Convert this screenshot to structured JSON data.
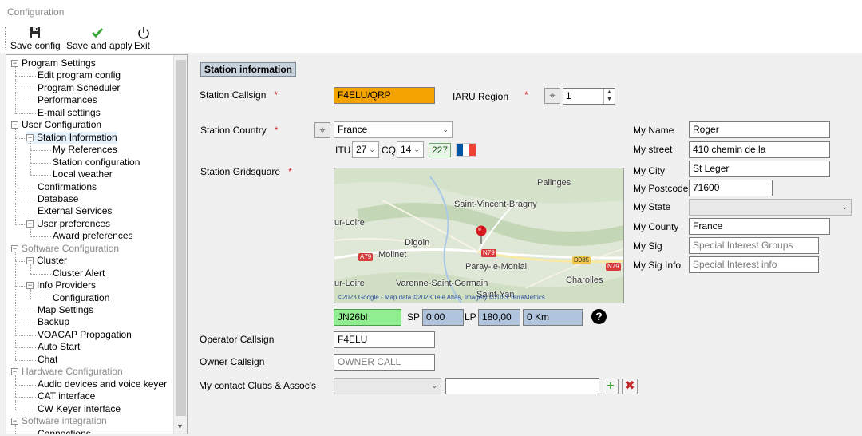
{
  "window": {
    "title": "Configuration"
  },
  "toolbar": {
    "save_config": "Save config",
    "save_and_apply": "Save and apply",
    "exit": "Exit"
  },
  "tree": [
    {
      "label": "Program Settings",
      "level": 0,
      "expanded": true
    },
    {
      "label": "Edit program config",
      "level": 1
    },
    {
      "label": "Program Scheduler",
      "level": 1
    },
    {
      "label": "Performances",
      "level": 1
    },
    {
      "label": "E-mail settings",
      "level": 1
    },
    {
      "label": "User Configuration",
      "level": 0,
      "expanded": true
    },
    {
      "label": "Station Information",
      "level": 1,
      "expanded": true,
      "selected": true
    },
    {
      "label": "My References",
      "level": 2
    },
    {
      "label": "Station configuration",
      "level": 2
    },
    {
      "label": "Local weather",
      "level": 2
    },
    {
      "label": "Confirmations",
      "level": 1
    },
    {
      "label": "Database",
      "level": 1
    },
    {
      "label": "External Services",
      "level": 1
    },
    {
      "label": "User preferences",
      "level": 1,
      "expanded": true
    },
    {
      "label": "Award preferences",
      "level": 2
    },
    {
      "label": "Software Configuration",
      "level": 0,
      "expanded": true,
      "grey": true
    },
    {
      "label": "Cluster",
      "level": 1,
      "expanded": true
    },
    {
      "label": "Cluster Alert",
      "level": 2
    },
    {
      "label": "Info Providers",
      "level": 1,
      "expanded": true
    },
    {
      "label": "Configuration",
      "level": 2
    },
    {
      "label": "Map Settings",
      "level": 1
    },
    {
      "label": "Backup",
      "level": 1
    },
    {
      "label": "VOACAP Propagation",
      "level": 1
    },
    {
      "label": "Auto Start",
      "level": 1
    },
    {
      "label": "Chat",
      "level": 1
    },
    {
      "label": "Hardware Configuration",
      "level": 0,
      "expanded": true,
      "grey": true
    },
    {
      "label": "Audio devices and voice keyer",
      "level": 1
    },
    {
      "label": "CAT interface",
      "level": 1
    },
    {
      "label": "CW Keyer interface",
      "level": 1
    },
    {
      "label": "Software integration",
      "level": 0,
      "expanded": true,
      "grey": true
    },
    {
      "label": "Connections",
      "level": 1
    }
  ],
  "station": {
    "section_title": "Station information",
    "required_mark": "*",
    "callsign_label": "Station Callsign",
    "callsign_value": "F4ELU/QRP",
    "iaru_label": "IARU Region",
    "iaru_value": "1",
    "country_label": "Station Country",
    "country_value": "France",
    "itu_label": "ITU",
    "itu_value": "27",
    "cq_label": "CQ",
    "cq_value": "14",
    "dxcc_value": "227",
    "gridsquare_label": "Station Gridsquare",
    "grid_value": "JN26bl",
    "sp_label": "SP",
    "sp_value": "0,00",
    "lp_label": "LP",
    "lp_value": "180,00",
    "distance_value": "0 Km",
    "operator_label": "Operator Callsign",
    "operator_value": "F4ELU",
    "owner_label": "Owner Callsign",
    "owner_placeholder": "OWNER CALL",
    "clubs_label": "My contact Clubs & Assoc's"
  },
  "map": {
    "places": [
      "Palinges",
      "Saint-Vincent-Bragny",
      "ur-Loire",
      "Digoin",
      "Molinet",
      "Paray-le-Monial",
      "Charolles",
      "ur-Loire",
      "Varenne-Saint-Germain",
      "Saint-Yan"
    ],
    "roads": [
      "A79",
      "N79",
      "D985",
      "N79"
    ],
    "attribution": "©2023 Google - Map data ©2023 Tele Atlas, Imagery ©2023 TerraMetrics"
  },
  "personal": {
    "name_label": "My Name",
    "name_value": "Roger",
    "street_label": "My street",
    "street_value": "410 chemin de la",
    "city_label": "My City",
    "city_value": "St Leger",
    "postcode_label": "My Postcode",
    "postcode_value": "71600",
    "state_label": "My State",
    "state_value": "",
    "county_label": "My County",
    "county_value": "France",
    "sig_label": "My Sig",
    "sig_placeholder": "Special Interest Groups",
    "siginfo_label": "My Sig Info",
    "siginfo_placeholder": "Special Interest info"
  },
  "colors": {
    "callsign_bg": "#f5a300",
    "grid_bg": "#90ee90",
    "bearing_bg": "#b0c4de"
  }
}
